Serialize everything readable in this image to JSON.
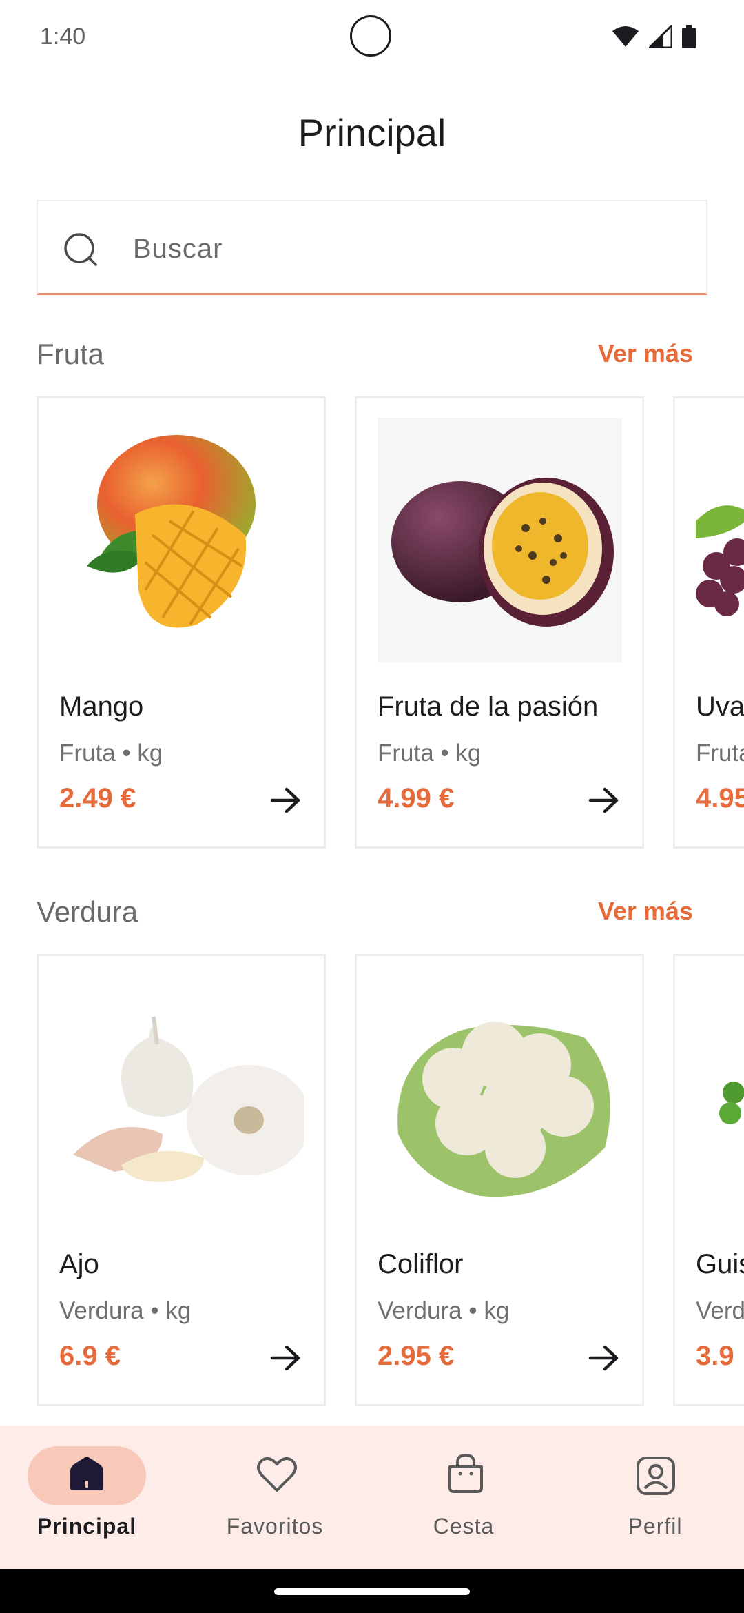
{
  "status_bar": {
    "time": "1:40"
  },
  "page_title": "Principal",
  "search": {
    "placeholder": "Buscar",
    "value": ""
  },
  "sections": [
    {
      "title": "Fruta",
      "link": "Ver más",
      "items": [
        {
          "name": "Mango",
          "category": "Fruta",
          "unit": "kg",
          "price": "2.49 €"
        },
        {
          "name": "Fruta de la pasión",
          "category": "Fruta",
          "unit": "kg",
          "price": "4.99 €"
        },
        {
          "name": "Uva",
          "category": "Fruta",
          "unit": "kg",
          "price": "4.95"
        }
      ]
    },
    {
      "title": "Verdura",
      "link": "Ver más",
      "items": [
        {
          "name": "Ajo",
          "category": "Verdura",
          "unit": "kg",
          "price": "6.9 €"
        },
        {
          "name": "Coliflor",
          "category": "Verdura",
          "unit": "kg",
          "price": "2.95 €"
        },
        {
          "name": "Guis",
          "category": "Verd",
          "unit": "",
          "price": "3.9"
        }
      ]
    }
  ],
  "bottom_nav": [
    {
      "label": "Principal",
      "icon": "home-icon",
      "active": true
    },
    {
      "label": "Favoritos",
      "icon": "heart-icon",
      "active": false
    },
    {
      "label": "Cesta",
      "icon": "basket-icon",
      "active": false
    },
    {
      "label": "Perfil",
      "icon": "profile-icon",
      "active": false
    }
  ],
  "colors": {
    "accent": "#e66a3a",
    "nav_background": "#fdece8",
    "nav_indicator": "#f8c9b8"
  }
}
